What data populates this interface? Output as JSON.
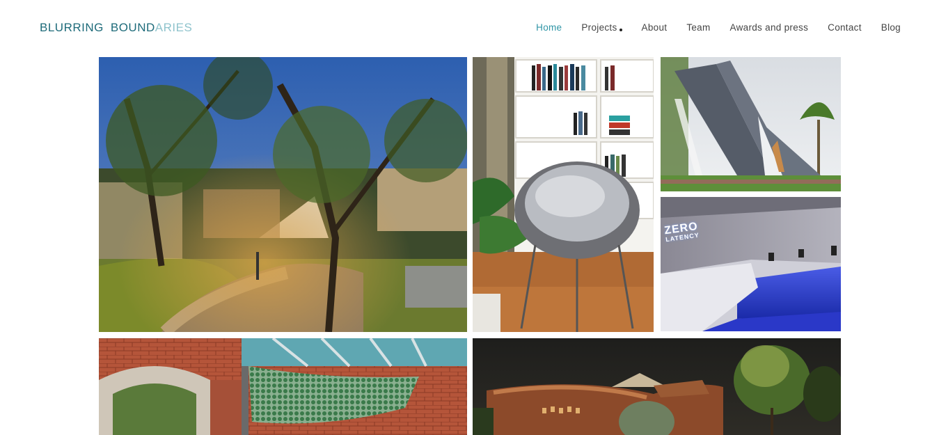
{
  "header": {
    "logo_word1": "BLURRING",
    "logo_word2a": "BOUND",
    "logo_word2b": "ARIES",
    "nav": [
      {
        "label": "Home",
        "active": true
      },
      {
        "label": "Projects",
        "has_dropdown": true
      },
      {
        "label": "About"
      },
      {
        "label": "Team"
      },
      {
        "label": "Awards and press"
      },
      {
        "label": "Contact"
      },
      {
        "label": "Blog"
      }
    ]
  },
  "gallery": {
    "signage": {
      "line1": "ZERO",
      "line2": "LATENCY"
    }
  },
  "colors": {
    "brand_dark": "#1e6b7a",
    "brand_light": "#8ec3cc",
    "nav_active": "#2f95a6",
    "nav_text": "#444444"
  }
}
